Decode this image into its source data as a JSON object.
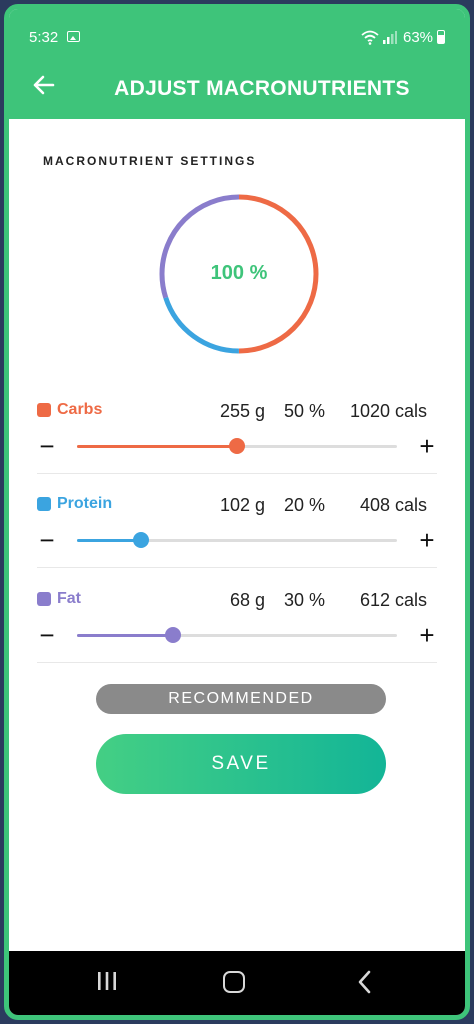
{
  "status_bar": {
    "time": "5:32",
    "battery": "63%",
    "battery_level": 0.63
  },
  "app_bar": {
    "title": "ADJUST MACRONUTRIENTS"
  },
  "section": {
    "title": "MACRONUTRIENT SETTINGS"
  },
  "summary": {
    "total_label": "100 %",
    "segments": [
      {
        "name": "Carbs",
        "percent": 50,
        "color": "#ee6a45"
      },
      {
        "name": "Protein",
        "percent": 20,
        "color": "#3ba4e0"
      },
      {
        "name": "Fat",
        "percent": 30,
        "color": "#8a7dcc"
      }
    ]
  },
  "macros": [
    {
      "name": "Carbs",
      "grams": "255 g",
      "percent": "50 %",
      "cals": "1020 cals",
      "slider_value": 0.5,
      "color": "#ee6a45"
    },
    {
      "name": "Protein",
      "grams": "102 g",
      "percent": "20 %",
      "cals": "408 cals",
      "slider_value": 0.2,
      "color": "#3ba4e0"
    },
    {
      "name": "Fat",
      "grams": "68 g",
      "percent": "30 %",
      "cals": "612 cals",
      "slider_value": 0.3,
      "color": "#8a7dcc"
    }
  ],
  "controls": {
    "minus": "−",
    "plus": "+"
  },
  "buttons": {
    "recommended": "RECOMMENDED",
    "save": "SAVE"
  },
  "colors": {
    "accent": "#3ec47a"
  }
}
